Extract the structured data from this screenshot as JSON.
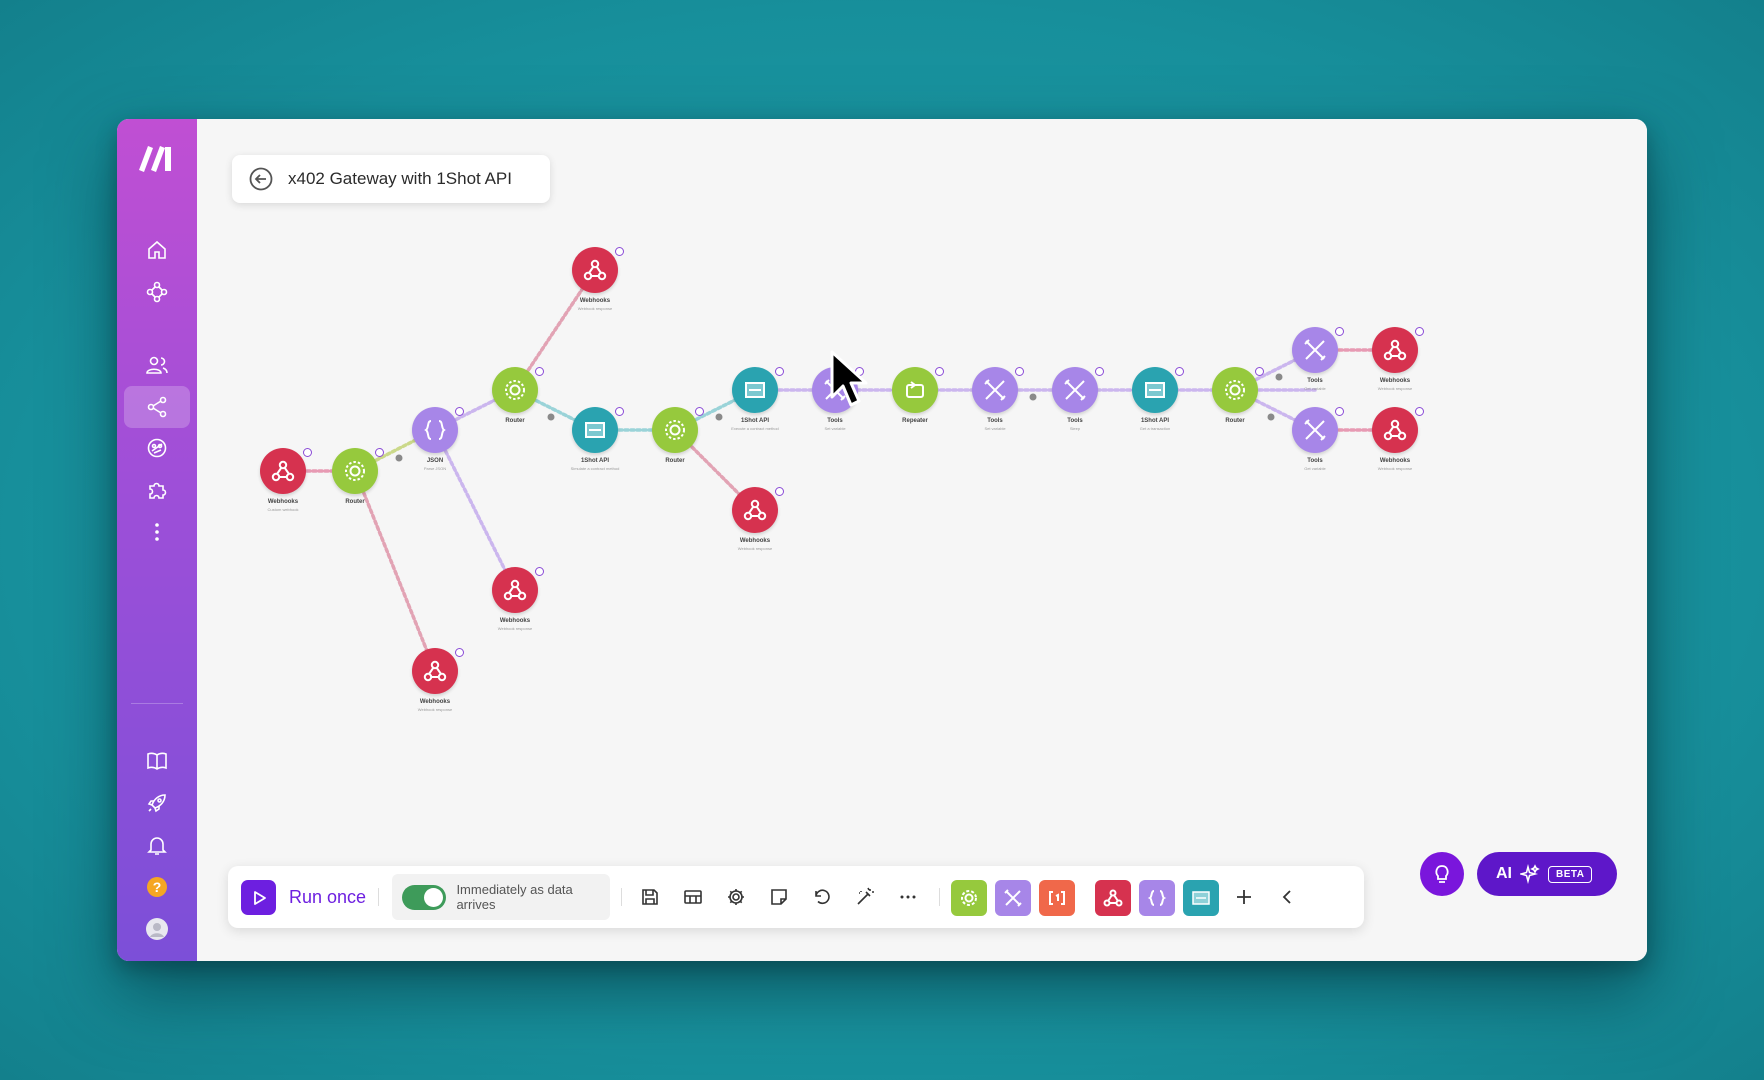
{
  "app": {
    "name": "Make"
  },
  "scenario": {
    "title": "x402 Gateway with 1Shot API"
  },
  "sidebar": {
    "items": [
      {
        "name": "home-icon"
      },
      {
        "name": "scenarios-icon"
      },
      {
        "name": "team-icon"
      },
      {
        "name": "connections-icon",
        "active": true
      },
      {
        "name": "templates-icon"
      },
      {
        "name": "apps-icon"
      },
      {
        "name": "more-icon"
      },
      {
        "name": "docs-icon"
      },
      {
        "name": "whats-new-icon"
      },
      {
        "name": "notifications-icon"
      },
      {
        "name": "help-icon"
      },
      {
        "name": "avatar"
      }
    ]
  },
  "colors": {
    "webhooks": "#d6324f",
    "router": "#96c93d",
    "json": "#a786e8",
    "oneshot": "#2aa3b0",
    "tools": "#a786e8",
    "repeater": "#96c93d",
    "run": "#6d1fe0",
    "ai": "#5e17c9"
  },
  "nodes": [
    {
      "id": "wh1",
      "label": "Webhooks",
      "type": "webhooks",
      "sub": "Custom webhook"
    },
    {
      "id": "r1",
      "label": "Router",
      "type": "router"
    },
    {
      "id": "json1",
      "label": "JSON",
      "type": "json",
      "sub": "Parse JSON"
    },
    {
      "id": "r2",
      "label": "Router",
      "type": "router"
    },
    {
      "id": "wh2",
      "label": "Webhooks",
      "type": "webhooks",
      "sub": "Webhook response"
    },
    {
      "id": "wh3",
      "label": "Webhooks",
      "type": "webhooks",
      "sub": "Webhook response"
    },
    {
      "id": "wh4",
      "label": "Webhooks",
      "type": "webhooks",
      "sub": "Webhook response"
    },
    {
      "id": "api1",
      "label": "1Shot API",
      "type": "oneshot",
      "sub": "Simulate a contract method"
    },
    {
      "id": "r3",
      "label": "Router",
      "type": "router"
    },
    {
      "id": "wh5",
      "label": "Webhooks",
      "type": "webhooks",
      "sub": "Webhook response"
    },
    {
      "id": "api2",
      "label": "1Shot API",
      "type": "oneshot",
      "sub": "Execute a contract method"
    },
    {
      "id": "t1",
      "label": "Tools",
      "type": "tools",
      "sub": "Set variable"
    },
    {
      "id": "rep",
      "label": "Repeater",
      "type": "repeater"
    },
    {
      "id": "t2",
      "label": "Tools",
      "type": "tools",
      "sub": "Set variable"
    },
    {
      "id": "t3",
      "label": "Tools",
      "type": "tools",
      "sub": "Sleep"
    },
    {
      "id": "api3",
      "label": "1Shot API",
      "type": "oneshot",
      "sub": "Get a transaction"
    },
    {
      "id": "r4",
      "label": "Router",
      "type": "router"
    },
    {
      "id": "t4",
      "label": "Tools",
      "type": "tools",
      "sub": "Get variable"
    },
    {
      "id": "wh6",
      "label": "Webhooks",
      "type": "webhooks",
      "sub": "Webhook response"
    },
    {
      "id": "t5",
      "label": "Tools",
      "type": "tools",
      "sub": "Get variable"
    },
    {
      "id": "wh7",
      "label": "Webhooks",
      "type": "webhooks",
      "sub": "Webhook response"
    }
  ],
  "toolbar": {
    "run_label": "Run once",
    "schedule_label": "Immediately as data arrives",
    "schedule_on": true,
    "actions": [
      "save-icon",
      "scheduling-icon",
      "settings-icon",
      "notes-icon",
      "undo-icon",
      "auto-align-icon",
      "more-icon"
    ],
    "modules": [
      "flow-control",
      "tools",
      "text-parser",
      "webhooks",
      "json",
      "oneshot-api"
    ]
  },
  "assist": {
    "ai_label": "AI",
    "beta_label": "BETA"
  }
}
